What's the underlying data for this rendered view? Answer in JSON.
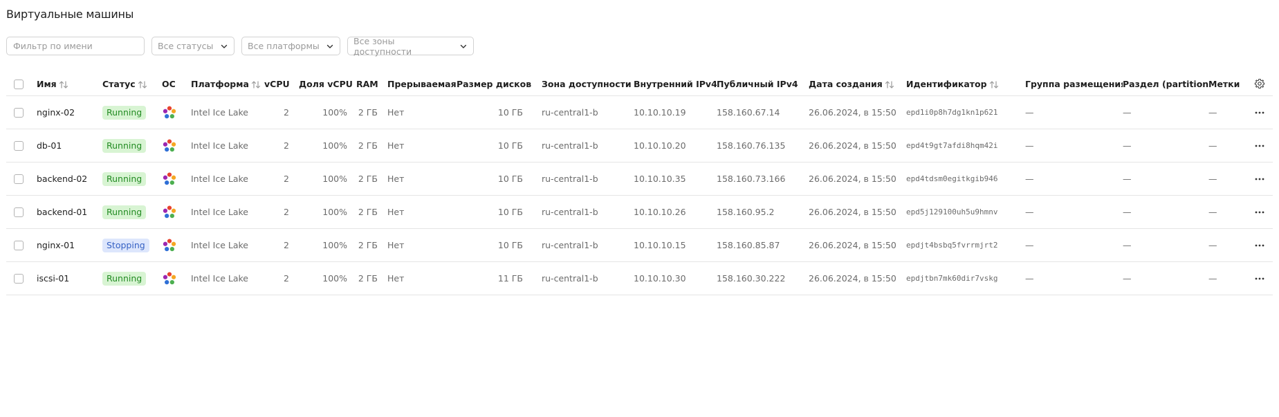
{
  "page_title": "Виртуальные машины",
  "filters": {
    "name_placeholder": "Фильтр по имени",
    "status_label": "Все статусы",
    "platform_label": "Все платформы",
    "zone_label": "Все зоны доступности"
  },
  "table": {
    "headers": {
      "name": "Имя",
      "status": "Статус",
      "os": "ОС",
      "platform": "Платформа",
      "vcpu": "vCPU",
      "vcpu_share": "Доля vCPU",
      "ram": "RAM",
      "preemptible": "Прерываемая",
      "disk_size": "Размер дисков",
      "zone": "Зона доступности",
      "internal_ip": "Внутренний IPv4",
      "public_ip": "Публичный IPv4",
      "created": "Дата создания",
      "id": "Идентификатор",
      "placement_group": "Группа размещения",
      "partition": "Раздел (partition)",
      "labels": "Метки"
    },
    "rows": [
      {
        "name": "nginx-02",
        "status": "Running",
        "platform": "Intel Ice Lake",
        "vcpu": "2",
        "vcpu_share": "100%",
        "ram": "2 ГБ",
        "preemptible": "Нет",
        "disk_size": "10 ГБ",
        "zone": "ru-central1-b",
        "internal_ip": "10.10.10.19",
        "public_ip": "158.160.67.14",
        "created": "26.06.2024, в 15:50",
        "id": "epd1i0p8h7dg1kn1p621",
        "placement_group": "—",
        "partition": "—",
        "labels": "—"
      },
      {
        "name": "db-01",
        "status": "Running",
        "platform": "Intel Ice Lake",
        "vcpu": "2",
        "vcpu_share": "100%",
        "ram": "2 ГБ",
        "preemptible": "Нет",
        "disk_size": "10 ГБ",
        "zone": "ru-central1-b",
        "internal_ip": "10.10.10.20",
        "public_ip": "158.160.76.135",
        "created": "26.06.2024, в 15:50",
        "id": "epd4t9gt7afdi8hqm42i",
        "placement_group": "—",
        "partition": "—",
        "labels": "—"
      },
      {
        "name": "backend-02",
        "status": "Running",
        "platform": "Intel Ice Lake",
        "vcpu": "2",
        "vcpu_share": "100%",
        "ram": "2 ГБ",
        "preemptible": "Нет",
        "disk_size": "10 ГБ",
        "zone": "ru-central1-b",
        "internal_ip": "10.10.10.35",
        "public_ip": "158.160.73.166",
        "created": "26.06.2024, в 15:50",
        "id": "epd4tdsm0egitkgib946",
        "placement_group": "—",
        "partition": "—",
        "labels": "—"
      },
      {
        "name": "backend-01",
        "status": "Running",
        "platform": "Intel Ice Lake",
        "vcpu": "2",
        "vcpu_share": "100%",
        "ram": "2 ГБ",
        "preemptible": "Нет",
        "disk_size": "10 ГБ",
        "zone": "ru-central1-b",
        "internal_ip": "10.10.10.26",
        "public_ip": "158.160.95.2",
        "created": "26.06.2024, в 15:50",
        "id": "epd5j129100uh5u9hmnv",
        "placement_group": "—",
        "partition": "—",
        "labels": "—"
      },
      {
        "name": "nginx-01",
        "status": "Stopping",
        "platform": "Intel Ice Lake",
        "vcpu": "2",
        "vcpu_share": "100%",
        "ram": "2 ГБ",
        "preemptible": "Нет",
        "disk_size": "10 ГБ",
        "zone": "ru-central1-b",
        "internal_ip": "10.10.10.15",
        "public_ip": "158.160.85.87",
        "created": "26.06.2024, в 15:50",
        "id": "epdjt4bsbq5fvrrmjrt2",
        "placement_group": "—",
        "partition": "—",
        "labels": "—"
      },
      {
        "name": "iscsi-01",
        "status": "Running",
        "platform": "Intel Ice Lake",
        "vcpu": "2",
        "vcpu_share": "100%",
        "ram": "2 ГБ",
        "preemptible": "Нет",
        "disk_size": "11 ГБ",
        "zone": "ru-central1-b",
        "internal_ip": "10.10.10.30",
        "public_ip": "158.160.30.222",
        "created": "26.06.2024, в 15:50",
        "id": "epdjtbn7mk60dir7vskg",
        "placement_group": "—",
        "partition": "—",
        "labels": "—"
      }
    ]
  },
  "icons": {
    "os": "os-logo-icon",
    "sort": "sort-arrows-icon",
    "settings": "gear-icon",
    "row_menu": "more-horizontal-icon",
    "dropdown": "chevron-down-icon"
  },
  "colors": {
    "running_bg": "#d8f4d3",
    "running_text": "#228b22",
    "stopping_bg": "#dde6fc",
    "stopping_text": "#3561c4"
  }
}
